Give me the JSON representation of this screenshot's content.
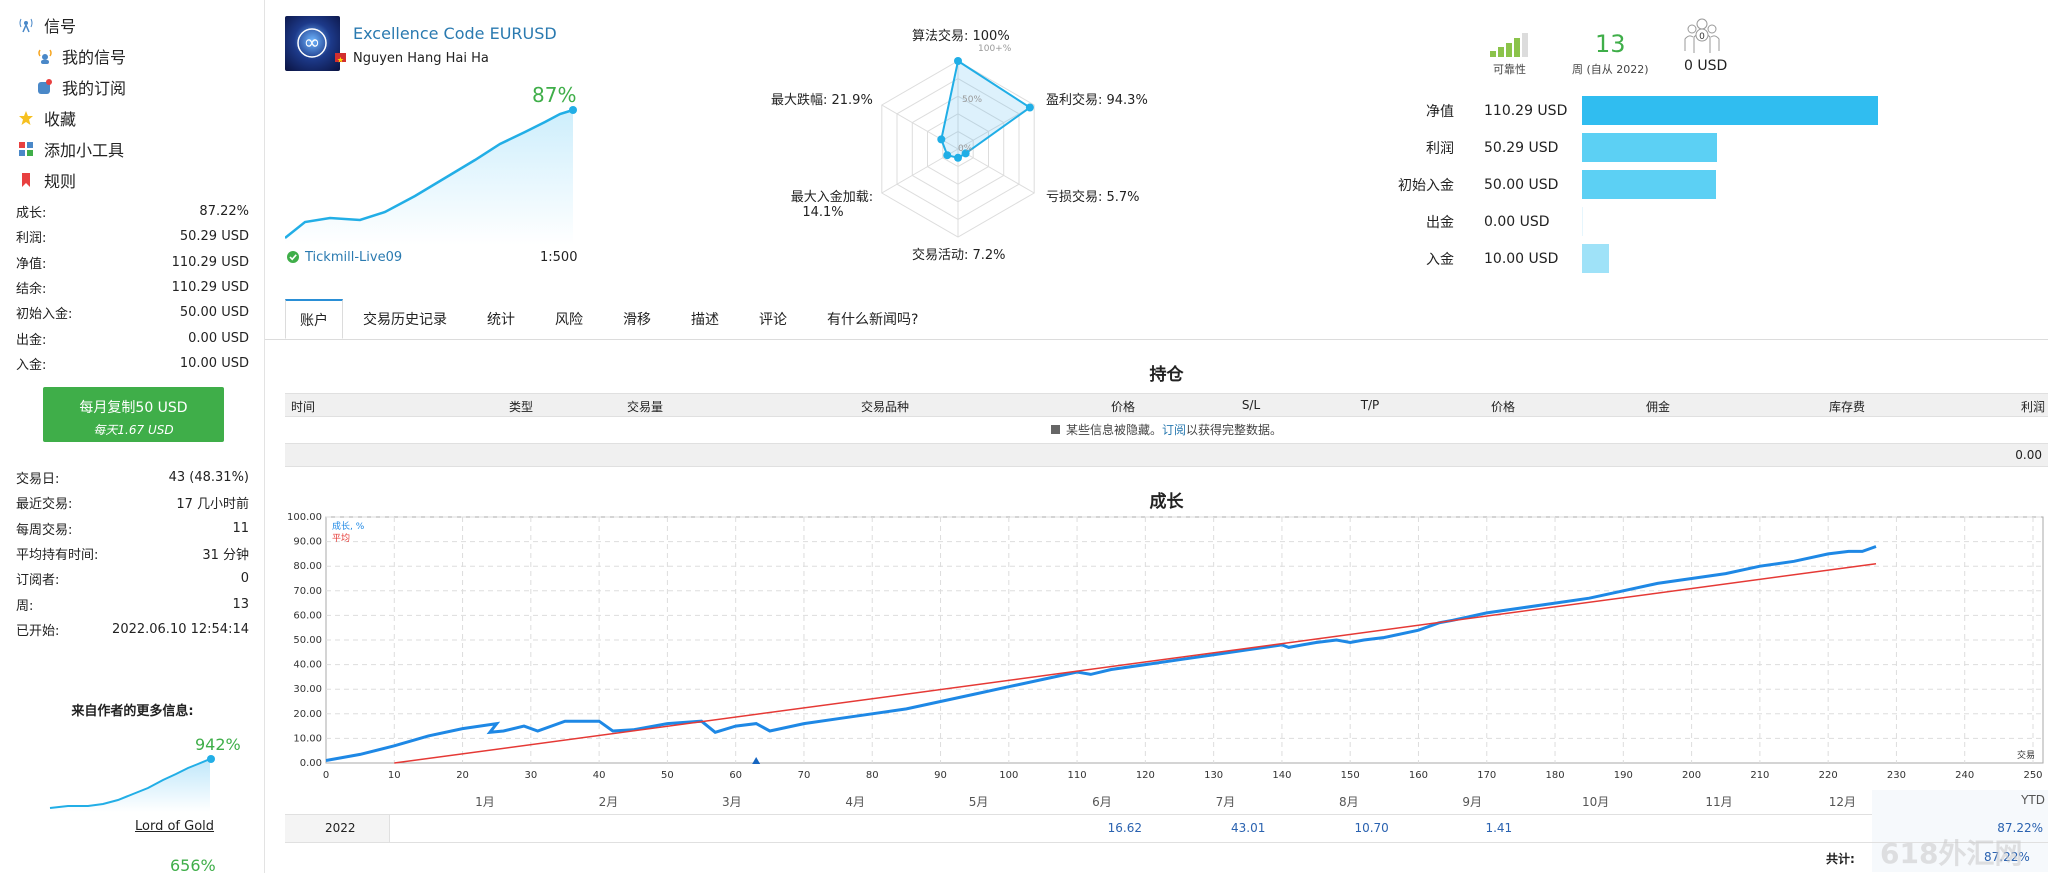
{
  "sidebar": {
    "nav": [
      {
        "label": "信号",
        "icon": "antenna-icon",
        "indent": false
      },
      {
        "label": "我的信号",
        "icon": "signal-person-icon",
        "indent": true
      },
      {
        "label": "我的订阅",
        "icon": "subscription-icon",
        "indent": true
      },
      {
        "label": "收藏",
        "icon": "star-icon",
        "indent": false
      },
      {
        "label": "添加小工具",
        "icon": "widget-icon",
        "indent": false
      },
      {
        "label": "规则",
        "icon": "bookmark-icon",
        "indent": false
      }
    ],
    "stats": [
      {
        "label": "成长:",
        "value": "87.22%"
      },
      {
        "label": "利润:",
        "value": "50.29 USD"
      },
      {
        "label": "净值:",
        "value": "110.29 USD"
      },
      {
        "label": "结余:",
        "value": "110.29 USD"
      },
      {
        "label": "初始入金:",
        "value": "50.00 USD"
      },
      {
        "label": "出金:",
        "value": "0.00 USD"
      },
      {
        "label": "入金:",
        "value": "10.00 USD"
      }
    ],
    "copy_button": {
      "line1": "每月复制50 USD",
      "line2": "每天1.67 USD"
    },
    "stats2": [
      {
        "label": "交易日:",
        "value": "43 (48.31%)"
      },
      {
        "label": "最近交易:",
        "value": "17 几小时前"
      },
      {
        "label": "每周交易:",
        "value": "11"
      },
      {
        "label": "平均持有时间:",
        "value": "31 分钟"
      },
      {
        "label": "订阅者:",
        "value": "0"
      },
      {
        "label": "周:",
        "value": "13"
      },
      {
        "label": "已开始:",
        "value": "2022.06.10 12:54:14"
      }
    ],
    "more_title": "来自作者的更多信息:",
    "more_signals": [
      {
        "growth": "942%",
        "name": "Lord of Gold"
      },
      {
        "growth": "656%"
      }
    ]
  },
  "profile": {
    "name": "Excellence Code EURUSD",
    "author": "Nguyen Hang Hai Ha",
    "growth": "87%",
    "broker": "Tickmill-Live09",
    "leverage": "1:500"
  },
  "radar": {
    "labels": {
      "top": "算法交易: 100%",
      "right_top": "盈利交易: 94.3%",
      "right_bottom": "亏损交易: 5.7%",
      "bottom": "交易活动: 7.2%",
      "left_bottom_1": "最大入金加载:",
      "left_bottom_2": "14.1%",
      "left_top": "最大跌幅: 21.9%"
    },
    "ring_labels": [
      "100+%",
      "50%",
      "0%"
    ],
    "values": [
      100,
      94.3,
      5.7,
      7.2,
      14.1,
      21.9
    ]
  },
  "summary": {
    "reliability_label": "可靠性",
    "weeks_value": "13",
    "weeks_label": "周 (自从 2022)",
    "subscribers_badge": "0",
    "subscribers_value": "0 USD",
    "bars": [
      {
        "label": "净值",
        "value": "110.29 USD",
        "amount": 110.29,
        "color": "#30bdf0"
      },
      {
        "label": "利润",
        "value": "50.29 USD",
        "amount": 50.29,
        "color": "#5cd0f4"
      },
      {
        "label": "初始入金",
        "value": "50.00 USD",
        "amount": 50.0,
        "color": "#5cd0f4"
      },
      {
        "label": "出金",
        "value": "0.00 USD",
        "amount": 0,
        "color": "#9fe2f8"
      },
      {
        "label": "入金",
        "value": "10.00 USD",
        "amount": 10.0,
        "color": "#9fe2f8"
      }
    ]
  },
  "tabs": [
    "账户",
    "交易历史记录",
    "统计",
    "风险",
    "滑移",
    "描述",
    "评论",
    "有什么新闻吗?"
  ],
  "positions": {
    "title": "持仓",
    "columns": [
      "时间",
      "类型",
      "交易量",
      "交易品种",
      "价格",
      "S/L",
      "T/P",
      "价格",
      "佣金",
      "库存费",
      "利润"
    ],
    "hidden_note_pre": "某些信息被隐藏。",
    "hidden_note_link": "订阅",
    "hidden_note_post": "以获得完整数据。",
    "total": "0.00"
  },
  "growth_chart_title": "成长",
  "chart_data": {
    "type": "line",
    "legend": [
      "成长, %",
      "平均"
    ],
    "xlabel": "交易",
    "x_ticks": [
      0,
      10,
      20,
      30,
      40,
      50,
      60,
      70,
      80,
      90,
      100,
      110,
      120,
      130,
      140,
      150,
      160,
      170,
      180,
      190,
      200,
      210,
      220,
      230,
      240,
      250
    ],
    "y_ticks": [
      "0.00",
      "10.00",
      "20.00",
      "30.00",
      "40.00",
      "50.00",
      "60.00",
      "70.00",
      "80.00",
      "90.00",
      "100.00"
    ],
    "xlim": [
      0,
      250
    ],
    "ylim": [
      0,
      100
    ],
    "series": [
      {
        "name": "成长, %",
        "color": "#1e88e5",
        "x": [
          0,
          5,
          10,
          15,
          20,
          25,
          24,
          26,
          29,
          31,
          35,
          40,
          42,
          45,
          50,
          55,
          57,
          60,
          63,
          65,
          70,
          75,
          80,
          85,
          90,
          95,
          100,
          105,
          110,
          112,
          115,
          120,
          125,
          130,
          135,
          140,
          141,
          143,
          145,
          148,
          150,
          152,
          155,
          160,
          163,
          165,
          170,
          175,
          180,
          185,
          190,
          195,
          200,
          205,
          210,
          215,
          220,
          223,
          225,
          227
        ],
        "y": [
          1,
          3.5,
          7,
          11,
          14,
          16,
          12.5,
          13,
          15,
          13,
          17,
          17,
          13,
          13.5,
          16,
          17,
          12.5,
          15,
          16,
          13,
          16,
          18,
          20,
          22,
          25,
          28,
          31,
          34,
          37,
          36,
          38,
          40,
          42,
          44,
          46,
          48,
          47,
          48,
          49,
          50,
          49,
          50,
          51,
          54,
          57,
          58,
          61,
          63,
          65,
          67,
          70,
          73,
          75,
          77,
          80,
          82,
          85,
          86,
          86,
          88
        ]
      },
      {
        "name": "平均",
        "color": "#e53935",
        "x": [
          10,
          227
        ],
        "y": [
          0,
          81
        ]
      }
    ],
    "marker_x": 63
  },
  "monthly": {
    "months": [
      "1月",
      "2月",
      "3月",
      "4月",
      "5月",
      "6月",
      "7月",
      "8月",
      "9月",
      "10月",
      "11月",
      "12月"
    ],
    "ytd_label": "YTD",
    "year": "2022",
    "values": [
      "",
      "",
      "",
      "",
      "",
      "16.62",
      "43.01",
      "10.70",
      "1.41",
      "",
      "",
      ""
    ],
    "ytd": "87.22%",
    "total_label": "共计:",
    "total_value": "87.22%"
  },
  "watermark": "618外汇网"
}
